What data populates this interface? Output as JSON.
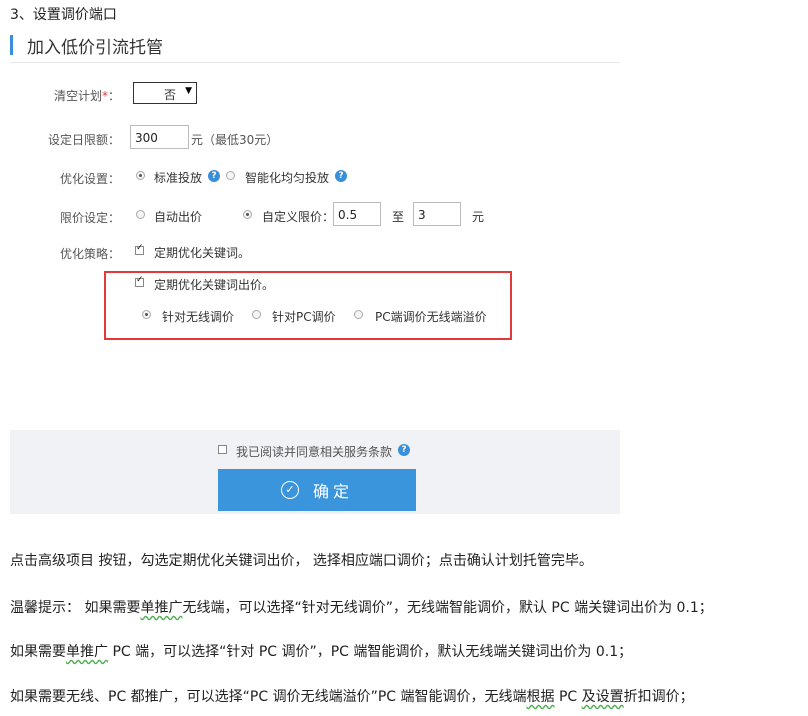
{
  "step_heading": "3、设置调价端口",
  "section_title": "加入低价引流托管",
  "form": {
    "clear_plan": {
      "label": "清空计划",
      "required_mark": "*",
      "colon": "：",
      "value": "否"
    },
    "daily_limit": {
      "label": "设定日限额：",
      "value": "300",
      "hint": "元（最低30元）"
    },
    "optimize": {
      "label": "优化设置：",
      "option1": "标准投放",
      "option2": "智能化均匀投放",
      "selected": "标准投放"
    },
    "price_limit": {
      "label": "限价设定：",
      "option_auto": "自动出价",
      "option_custom": "自定义限价：",
      "selected": "自定义限价",
      "min": "0.5",
      "to": "至",
      "max": "3",
      "unit": "元"
    },
    "strategy": {
      "label": "优化策略：",
      "keyword_opt": "定期优化关键词。",
      "bid_opt": "定期优化关键词出价。",
      "ports": [
        "针对无线调价",
        "针对PC调价",
        "PC端调价无线端溢价"
      ],
      "selected_port": "针对无线调价"
    }
  },
  "agreement_text": "我已阅读并同意相关服务条款",
  "confirm_label": "确定",
  "help_glyph": "?",
  "paragraphs": {
    "p1": "点击高级项目 按钮，勾选定期优化关键词出价， 选择相应端口调价；点击确认计划托管完毕。",
    "p2_a": "温馨提示： 如果需要",
    "p2_b": "单推广",
    "p2_c": "无线端，可以选择“针对无线调价”，无线端智能调价，默认 PC 端关键词出价为 0.1；",
    "p3_a": "如果需要",
    "p3_b": "单推广",
    "p3_c": " PC 端，可以选择“针对 PC 调价”，PC 端智能调价，默认无线端关键词出价为 0.1；",
    "p4_a": "如果需要无线、PC 都推广，可以选择“PC 调价无线端溢价”PC 端智能调价，无线端",
    "p4_b": "根据",
    "p4_c": " PC ",
    "p4_d": "及设置",
    "p4_e": "折扣调价；"
  },
  "colors": {
    "accent": "#3a95dd",
    "highlight_border": "#e23a3a",
    "required": "#e23a3a"
  }
}
